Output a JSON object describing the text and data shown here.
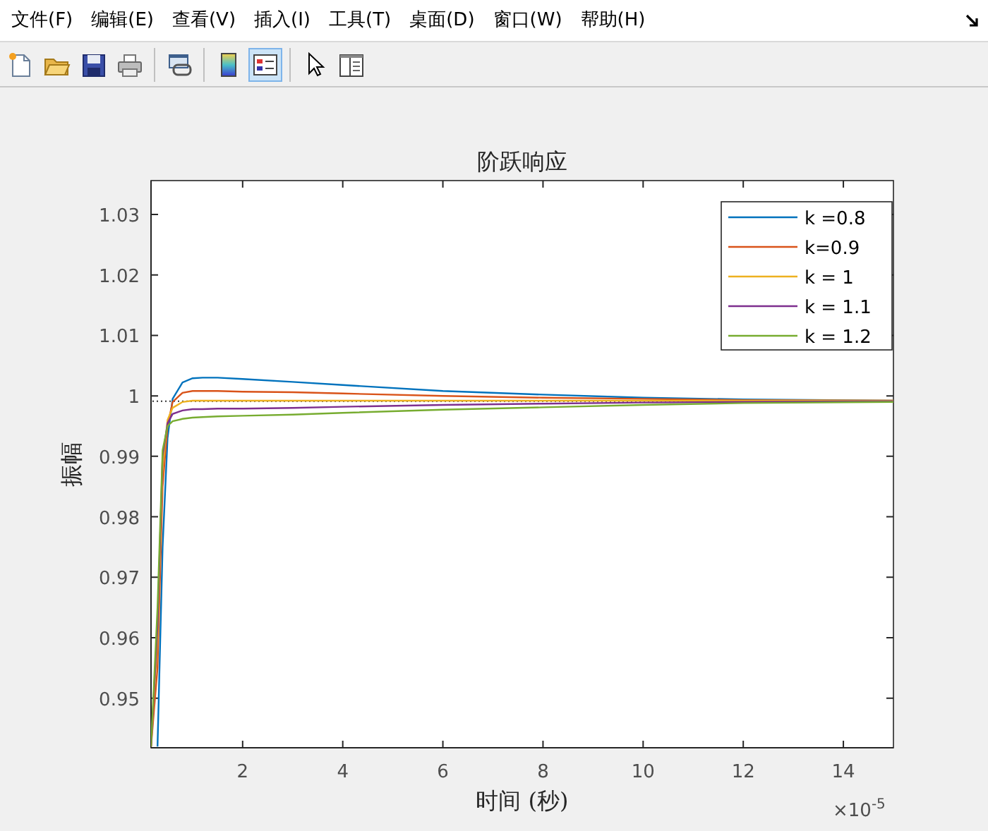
{
  "menu": [
    "文件(F)",
    "编辑(E)",
    "查看(V)",
    "插入(I)",
    "工具(T)",
    "桌面(D)",
    "窗口(W)",
    "帮助(H)"
  ],
  "toolbar": [
    {
      "kind": "new",
      "pressed": false
    },
    {
      "kind": "open",
      "pressed": false
    },
    {
      "kind": "save",
      "pressed": false
    },
    {
      "kind": "print",
      "pressed": false
    },
    {
      "kind": "separator"
    },
    {
      "kind": "link",
      "pressed": false
    },
    {
      "kind": "separator"
    },
    {
      "kind": "colorbar",
      "pressed": false
    },
    {
      "kind": "legend",
      "pressed": true
    },
    {
      "kind": "separator"
    },
    {
      "kind": "pointer",
      "pressed": false
    },
    {
      "kind": "inspector",
      "pressed": false
    }
  ],
  "figure": {
    "chart_data": {
      "type": "line",
      "title": "阶跃响应",
      "xlabel": "时间 (秒)",
      "ylabel": "振幅",
      "x": [
        0.17,
        0.3,
        0.4,
        0.5,
        0.6,
        0.8,
        1,
        1.2,
        1.5,
        2,
        3,
        4,
        6,
        8,
        10,
        12,
        15
      ],
      "legend": "upper right",
      "ref_lines": [
        {
          "axis": "y",
          "value": 0.9991
        }
      ],
      "xlim": [
        0.17,
        15
      ],
      "ylim": [
        0.9418,
        1.0356
      ],
      "xticks": [
        2,
        4,
        6,
        8,
        10,
        12,
        14
      ],
      "yticks": [
        {
          "value": 0.95,
          "label": "0.95"
        },
        {
          "value": 0.96,
          "label": "0.96"
        },
        {
          "value": 0.97,
          "label": "0.97"
        },
        {
          "value": 0.98,
          "label": "0.98"
        },
        {
          "value": 0.99,
          "label": "0.99"
        },
        {
          "value": 1,
          "label": "1"
        },
        {
          "value": 1.01,
          "label": "1.01"
        },
        {
          "value": 1.02,
          "label": "1.02"
        },
        {
          "value": 1.03,
          "label": "1.03"
        }
      ],
      "series": [
        {
          "name": "k =0.8",
          "color": "#0072bd",
          "values": [
            null,
            0.942,
            0.975,
            0.993,
            0.9995,
            1.0022,
            1.0029,
            1.003,
            1.003,
            1.0028,
            1.0023,
            1.0018,
            1.0008,
            1.0002,
            0.9997,
            0.9994,
            0.9992
          ]
        },
        {
          "name": "k=0.9",
          "color": "#d95319",
          "values": [
            0.942,
            0.955,
            0.985,
            0.995,
            0.999,
            1.0005,
            1.0008,
            1.0008,
            1.0008,
            1.0007,
            1.0006,
            1.0004,
            1.0,
            0.9997,
            0.9995,
            0.9993,
            0.9992
          ]
        },
        {
          "name": "k = 1",
          "color": "#edb120",
          "values": [
            0.942,
            0.96,
            0.988,
            0.996,
            0.998,
            0.999,
            0.9992,
            0.9992,
            0.9992,
            0.9992,
            0.9992,
            0.9992,
            0.9992,
            0.9992,
            0.9992,
            0.9992,
            0.9992
          ]
        },
        {
          "name": "k = 1.1",
          "color": "#7e2f8e",
          "values": [
            0.942,
            0.962,
            0.99,
            0.9955,
            0.997,
            0.9976,
            0.9978,
            0.9978,
            0.9979,
            0.9979,
            0.998,
            0.9982,
            0.9985,
            0.9987,
            0.9989,
            0.999,
            0.9991
          ]
        },
        {
          "name": "k = 1.2",
          "color": "#77ac30",
          "values": [
            0.942,
            0.965,
            0.991,
            0.995,
            0.9958,
            0.9962,
            0.9964,
            0.9965,
            0.9966,
            0.9967,
            0.9969,
            0.9972,
            0.9977,
            0.9981,
            0.9985,
            0.9988,
            0.999
          ]
        }
      ]
    },
    "x_exponent": "×10$^{-5}$"
  }
}
